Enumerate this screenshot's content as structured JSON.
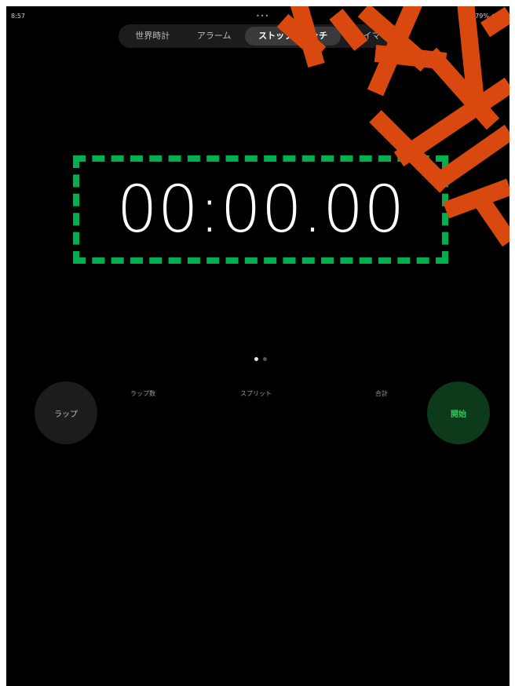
{
  "status_bar": {
    "time": "8:57",
    "center": "•••",
    "battery_text": "79%"
  },
  "tabs": [
    {
      "label": "世界時計",
      "active": false
    },
    {
      "label": "アラーム",
      "active": false
    },
    {
      "label": "ストップウォッチ",
      "active": true
    },
    {
      "label": "タイマー",
      "active": false
    }
  ],
  "stopwatch": {
    "time": "00:00.00"
  },
  "columns": {
    "laps": "ラップ数",
    "split": "スプリット",
    "total": "合計"
  },
  "buttons": {
    "lap": "ラップ",
    "start": "開始"
  },
  "page_dots": {
    "count": 2,
    "active_index": 0
  },
  "colors": {
    "highlight_box": "#00b050",
    "annotation": "#d9480f",
    "start_text": "#2ec85a"
  }
}
